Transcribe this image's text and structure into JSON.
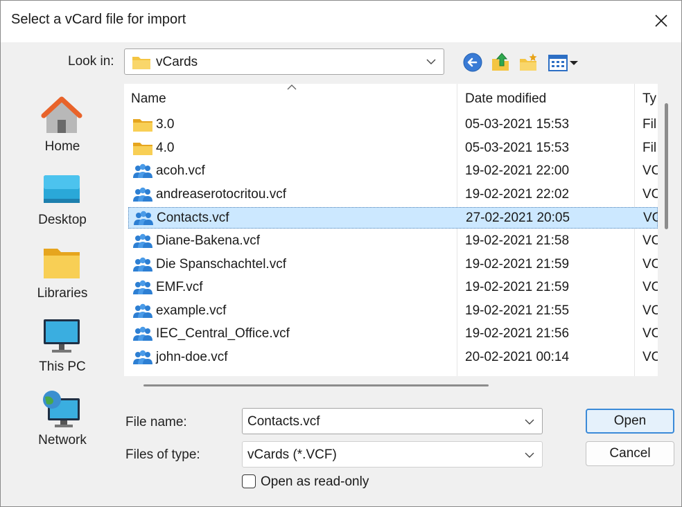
{
  "window": {
    "title": "Select a vCard file for import"
  },
  "lookin": {
    "label": "Look in:",
    "value": "vCards"
  },
  "toolbar": {
    "icons": [
      "back-icon",
      "up-folder-icon",
      "new-folder-icon",
      "view-menu-icon"
    ]
  },
  "places": [
    {
      "label": "Home",
      "icon": "home-icon"
    },
    {
      "label": "Desktop",
      "icon": "desktop-icon"
    },
    {
      "label": "Libraries",
      "icon": "libraries-icon"
    },
    {
      "label": "This PC",
      "icon": "this-pc-icon"
    },
    {
      "label": "Network",
      "icon": "network-icon"
    }
  ],
  "list": {
    "columns": {
      "name": "Name",
      "date": "Date modified",
      "type": "Ty"
    },
    "rows": [
      {
        "name": "3.0",
        "date": "05-03-2021 15:53",
        "type": "Fil",
        "kind": "folder"
      },
      {
        "name": "4.0",
        "date": "05-03-2021 15:53",
        "type": "Fil",
        "kind": "folder"
      },
      {
        "name": "acoh.vcf",
        "date": "19-02-2021 22:00",
        "type": "VC",
        "kind": "vcard"
      },
      {
        "name": "andreaserotocritou.vcf",
        "date": "19-02-2021 22:02",
        "type": "VC",
        "kind": "vcard"
      },
      {
        "name": "Contacts.vcf",
        "date": "27-02-2021 20:05",
        "type": "VC",
        "kind": "vcard"
      },
      {
        "name": "Diane-Bakena.vcf",
        "date": "19-02-2021 21:58",
        "type": "VC",
        "kind": "vcard"
      },
      {
        "name": "Die Spanschachtel.vcf",
        "date": "19-02-2021 21:59",
        "type": "VC",
        "kind": "vcard"
      },
      {
        "name": "EMF.vcf",
        "date": "19-02-2021 21:59",
        "type": "VC",
        "kind": "vcard"
      },
      {
        "name": "example.vcf",
        "date": "19-02-2021 21:55",
        "type": "VC",
        "kind": "vcard"
      },
      {
        "name": "IEC_Central_Office.vcf",
        "date": "19-02-2021 21:56",
        "type": "VC",
        "kind": "vcard"
      },
      {
        "name": "john-doe.vcf",
        "date": "20-02-2021 00:14",
        "type": "VC",
        "kind": "vcard"
      }
    ],
    "selected_index": 4
  },
  "filename": {
    "label": "File name:",
    "value": "Contacts.vcf"
  },
  "filetype": {
    "label": "Files of type:",
    "value": "vCards (*.VCF)"
  },
  "buttons": {
    "open": "Open",
    "cancel": "Cancel"
  },
  "readonly": {
    "label": "Open as read-only",
    "checked": false
  },
  "colors": {
    "selection": "#cce8ff",
    "accent": "#3b8ad8",
    "folder": "#f4c542",
    "vcard": "#2d7fd3"
  }
}
